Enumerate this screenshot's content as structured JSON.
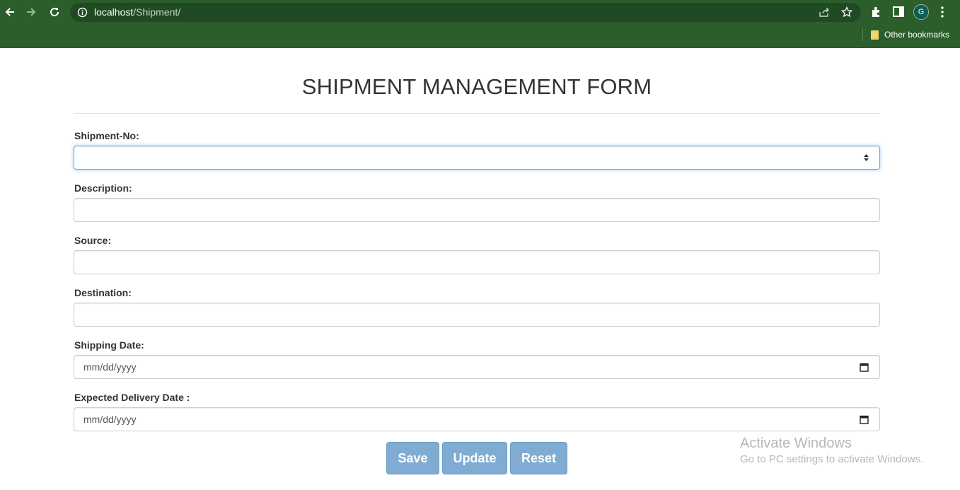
{
  "browser": {
    "url_host": "localhost",
    "url_path": "/Shipment/",
    "avatar_letter": "G",
    "bookmarks_label": "Other bookmarks",
    "icons": [
      "back-arrow-icon",
      "forward-arrow-icon",
      "reload-icon",
      "info-icon",
      "share-icon",
      "star-icon",
      "extensions-icon",
      "side-panel-icon",
      "menu-icon",
      "folder-icon"
    ]
  },
  "form": {
    "title": "SHIPMENT MANAGEMENT FORM",
    "fields": {
      "shipment_no": {
        "label": "Shipment-No:",
        "value": ""
      },
      "description": {
        "label": "Description:",
        "value": ""
      },
      "source": {
        "label": "Source:",
        "value": ""
      },
      "destination": {
        "label": "Destination:",
        "value": ""
      },
      "shipping_date": {
        "label": "Shipping Date:",
        "placeholder": "mm/dd/yyyy"
      },
      "expected_delivery_date": {
        "label": "Expected Delivery Date :",
        "placeholder": "mm/dd/yyyy"
      }
    },
    "buttons": {
      "save": "Save",
      "update": "Update",
      "reset": "Reset"
    }
  },
  "watermark": {
    "line1": "Activate Windows",
    "line2": "Go to PC settings to activate Windows."
  },
  "colors": {
    "chrome_bg": "#2b5e2b",
    "omnibox_bg": "#1f4a24",
    "button_bg": "#80acd3",
    "focus_border": "#66afe9",
    "text": "#333333"
  }
}
